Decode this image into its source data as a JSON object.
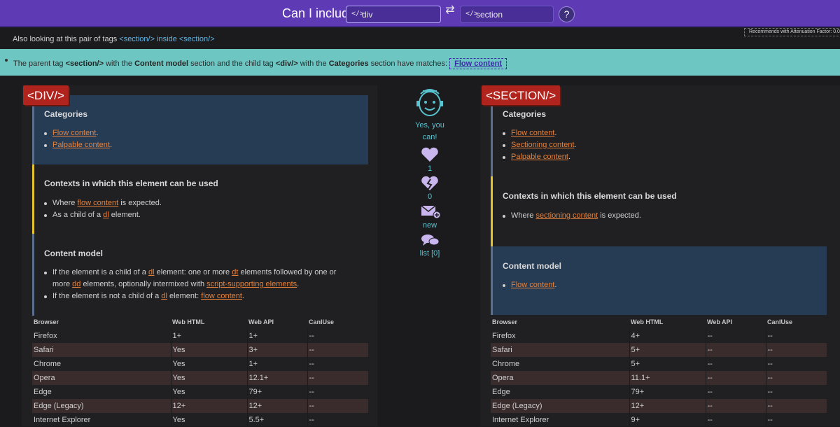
{
  "header": {
    "title": "Can I include",
    "parent_tag": "div",
    "child_tag": "section",
    "help_label": "?",
    "attenuation": "Recommends with Attenuation Factor: 0.0"
  },
  "also": {
    "prefix": "Also looking at this pair of tags",
    "link_text": "<section/> inside <section/>"
  },
  "match": {
    "t1": "The parent tag",
    "parent": "<section/>",
    "t2": "with the",
    "parent_section": "Content model",
    "t3": "section and the child tag",
    "child": "<div/>",
    "t4": "with the",
    "child_section": "Categories",
    "t5": "section have matches:",
    "match_link": "Flow content"
  },
  "middle": {
    "verdict": "Yes, you can!",
    "likes": "1",
    "dislikes": "0",
    "new_label": "new",
    "list_label": "list [0]"
  },
  "left": {
    "tag": "<DIV/>",
    "categories_title": "Categories",
    "categories": [
      {
        "link": "Flow content",
        "after": "."
      },
      {
        "link": "Palpable content",
        "after": "."
      }
    ],
    "contexts_title": "Contexts in which this element can be used",
    "contexts": [
      {
        "before": "Where",
        "link": "flow content",
        "after": "is expected."
      },
      {
        "before": "As a child of a",
        "link": "dl",
        "after": "element."
      }
    ],
    "content_title": "Content model",
    "content": {
      "i1_a": "If the element is a child of a",
      "i1_l1": "dl",
      "i1_b": "element: one or more",
      "i1_l2": "dt",
      "i1_c": "elements followed by one or",
      "i1_d": "more",
      "i1_l3": "dd",
      "i1_e": "elements, optionally intermixed with",
      "i1_l4": "script-supporting elements",
      "i1_f": ".",
      "i2_a": "If the element is not a child of a",
      "i2_l1": "dl",
      "i2_b": "element:",
      "i2_l2": "flow content",
      "i2_c": "."
    },
    "browsers": [
      [
        "Firefox",
        "1+",
        "1+",
        "--"
      ],
      [
        "Safari",
        "Yes",
        "3+",
        "--"
      ],
      [
        "Chrome",
        "Yes",
        "1+",
        "--"
      ],
      [
        "Opera",
        "Yes",
        "12.1+",
        "--"
      ],
      [
        "Edge",
        "Yes",
        "79+",
        "--"
      ],
      [
        "Edge (Legacy)",
        "12+",
        "12+",
        "--"
      ],
      [
        "Internet Explorer",
        "Yes",
        "5.5+",
        "--"
      ]
    ]
  },
  "right": {
    "tag": "<SECTION/>",
    "categories_title": "Categories",
    "categories": [
      {
        "link": "Flow content",
        "after": "."
      },
      {
        "link": "Sectioning content",
        "after": "."
      },
      {
        "link": "Palpable content",
        "after": "."
      }
    ],
    "contexts_title": "Contexts in which this element can be used",
    "contexts": [
      {
        "before": "Where",
        "link": "sectioning content",
        "after": "is expected."
      }
    ],
    "content_title": "Content model",
    "content_items": [
      {
        "link": "Flow content",
        "after": "."
      }
    ],
    "browsers": [
      [
        "Firefox",
        "4+",
        "--",
        "--"
      ],
      [
        "Safari",
        "5+",
        "--",
        "--"
      ],
      [
        "Chrome",
        "5+",
        "--",
        "--"
      ],
      [
        "Opera",
        "11.1+",
        "--",
        "--"
      ],
      [
        "Edge",
        "79+",
        "--",
        "--"
      ],
      [
        "Edge (Legacy)",
        "12+",
        "--",
        "--"
      ],
      [
        "Internet Explorer",
        "9+",
        "--",
        "--"
      ]
    ]
  },
  "table_headers": [
    "Browser",
    "Web HTML",
    "Web API",
    "CanIUse"
  ]
}
